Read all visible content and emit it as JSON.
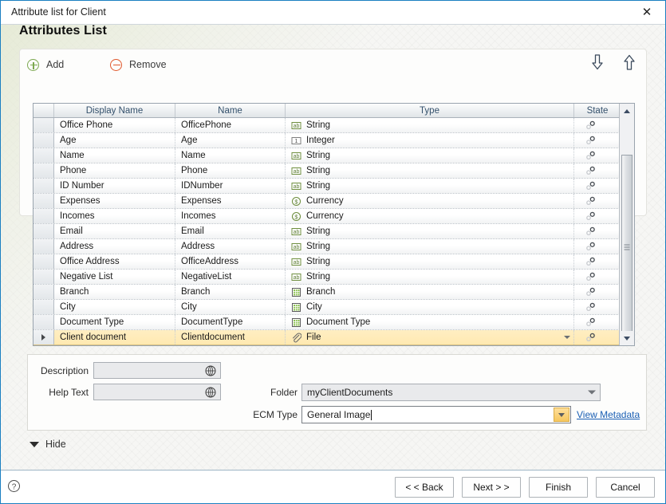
{
  "window": {
    "title": "Attribute list for Client",
    "close_icon": "close-icon"
  },
  "page": {
    "heading": "Attributes List"
  },
  "toolbar": {
    "add_label": "Add",
    "remove_label": "Remove",
    "move_down_icon": "arrow-down-icon",
    "move_up_icon": "arrow-up-icon"
  },
  "grid": {
    "columns": [
      "",
      "Display Name",
      "Name",
      "Type",
      "State"
    ],
    "rows": [
      {
        "display_name": "Office Phone",
        "name": "OfficePhone",
        "type": "String",
        "type_icon": "string-icon",
        "state_icon": "gear-icon",
        "selected": false
      },
      {
        "display_name": "Age",
        "name": "Age",
        "type": "Integer",
        "type_icon": "integer-icon",
        "state_icon": "gear-icon",
        "selected": false
      },
      {
        "display_name": "Name",
        "name": "Name",
        "type": "String",
        "type_icon": "string-icon",
        "state_icon": "gear-icon",
        "selected": false
      },
      {
        "display_name": "Phone",
        "name": "Phone",
        "type": "String",
        "type_icon": "string-icon",
        "state_icon": "gear-icon",
        "selected": false
      },
      {
        "display_name": "ID Number",
        "name": "IDNumber",
        "type": "String",
        "type_icon": "string-icon",
        "state_icon": "gear-icon",
        "selected": false
      },
      {
        "display_name": "Expenses",
        "name": "Expenses",
        "type": "Currency",
        "type_icon": "currency-icon",
        "state_icon": "gear-icon",
        "selected": false
      },
      {
        "display_name": "Incomes",
        "name": "Incomes",
        "type": "Currency",
        "type_icon": "currency-icon",
        "state_icon": "gear-icon",
        "selected": false
      },
      {
        "display_name": "Email",
        "name": "Email",
        "type": "String",
        "type_icon": "string-icon",
        "state_icon": "gear-icon",
        "selected": false
      },
      {
        "display_name": "Address",
        "name": "Address",
        "type": "String",
        "type_icon": "string-icon",
        "state_icon": "gear-icon",
        "selected": false
      },
      {
        "display_name": "Office Address",
        "name": "OfficeAddress",
        "type": "String",
        "type_icon": "string-icon",
        "state_icon": "gear-icon",
        "selected": false
      },
      {
        "display_name": "Negative List",
        "name": "NegativeList",
        "type": "String",
        "type_icon": "string-icon",
        "state_icon": "gear-icon",
        "selected": false
      },
      {
        "display_name": "Branch",
        "name": "Branch",
        "type": "Branch",
        "type_icon": "lookup-icon",
        "state_icon": "gear-icon",
        "selected": false
      },
      {
        "display_name": "City",
        "name": "City",
        "type": "City",
        "type_icon": "lookup-icon",
        "state_icon": "gear-icon",
        "selected": false
      },
      {
        "display_name": "Document Type",
        "name": "DocumentType",
        "type": "Document Type",
        "type_icon": "lookup-icon",
        "state_icon": "gear-icon",
        "selected": false
      },
      {
        "display_name": "Client document",
        "name": "Clientdocument",
        "type": "File",
        "type_icon": "file-icon",
        "state_icon": "gear-icon",
        "selected": true
      }
    ],
    "scrollbar": {
      "up_icon": "scroll-up-icon",
      "down_icon": "scroll-down-icon"
    }
  },
  "form": {
    "description_label": "Description",
    "description_value": "",
    "description_globe_icon": "globe-icon",
    "help_text_label": "Help Text",
    "help_text_value": "",
    "help_text_globe_icon": "globe-icon",
    "folder_label": "Folder",
    "folder_value": "myClientDocuments",
    "ecm_type_label": "ECM Type",
    "ecm_type_value": "General Image",
    "view_metadata_label": "View Metadata"
  },
  "hide": {
    "label": "Hide",
    "icon": "triangle-down-icon"
  },
  "footer": {
    "help_icon": "question-mark-icon",
    "buttons": [
      {
        "label": "< < Back"
      },
      {
        "label": "Next > >"
      },
      {
        "label": "Finish"
      },
      {
        "label": "Cancel"
      }
    ]
  },
  "colors": {
    "window_border": "#1a7fc1",
    "selection": "#ffeec2",
    "link": "#1a5fb4",
    "add_green": "#7ba84f",
    "remove_red": "#e0582c"
  }
}
